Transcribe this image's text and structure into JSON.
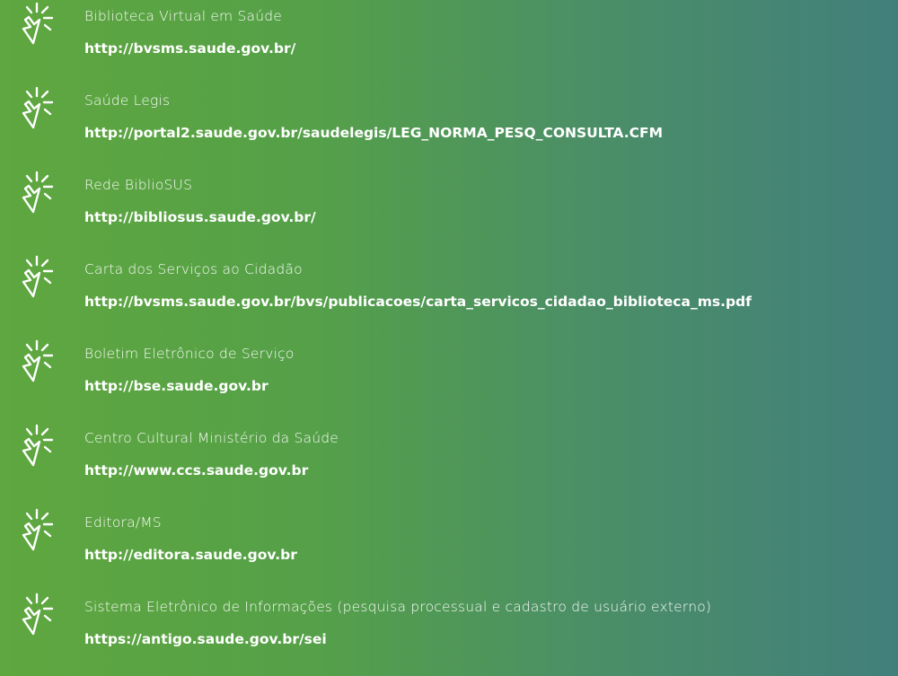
{
  "links": [
    {
      "title": "Biblioteca Virtual em Saúde",
      "url": "http://bvsms.saude.gov.br/",
      "icon": "cursor-click-icon"
    },
    {
      "title": "Saúde Legis",
      "url": "http://portal2.saude.gov.br/saudelegis/LEG_NORMA_PESQ_CONSULTA.CFM",
      "icon": "cursor-click-icon"
    },
    {
      "title": "Rede BiblioSUS",
      "url": "http://bibliosus.saude.gov.br/",
      "icon": "cursor-click-icon"
    },
    {
      "title": "Carta dos Serviços ao Cidadão",
      "url": "http://bvsms.saude.gov.br/bvs/publicacoes/carta_servicos_cidadao_biblioteca_ms.pdf",
      "icon": "cursor-click-icon"
    },
    {
      "title": "Boletim Eletrônico de Serviço",
      "url": "http://bse.saude.gov.br",
      "icon": "cursor-click-icon"
    },
    {
      "title": "Centro Cultural Ministério da Saúde",
      "url": "http://www.ccs.saude.gov.br",
      "icon": "cursor-click-icon"
    },
    {
      "title": "Editora/MS",
      "url": "http://editora.saude.gov.br",
      "icon": "cursor-click-icon"
    },
    {
      "title": "Sistema Eletrônico de Informações (pesquisa processual e cadastro de usuário externo)",
      "url": "https://antigo.saude.gov.br/sei",
      "icon": "cursor-click-icon"
    }
  ],
  "colors": {
    "background_start": "#5fa73f",
    "background_end": "#427f7c",
    "text": "#ffffff"
  }
}
